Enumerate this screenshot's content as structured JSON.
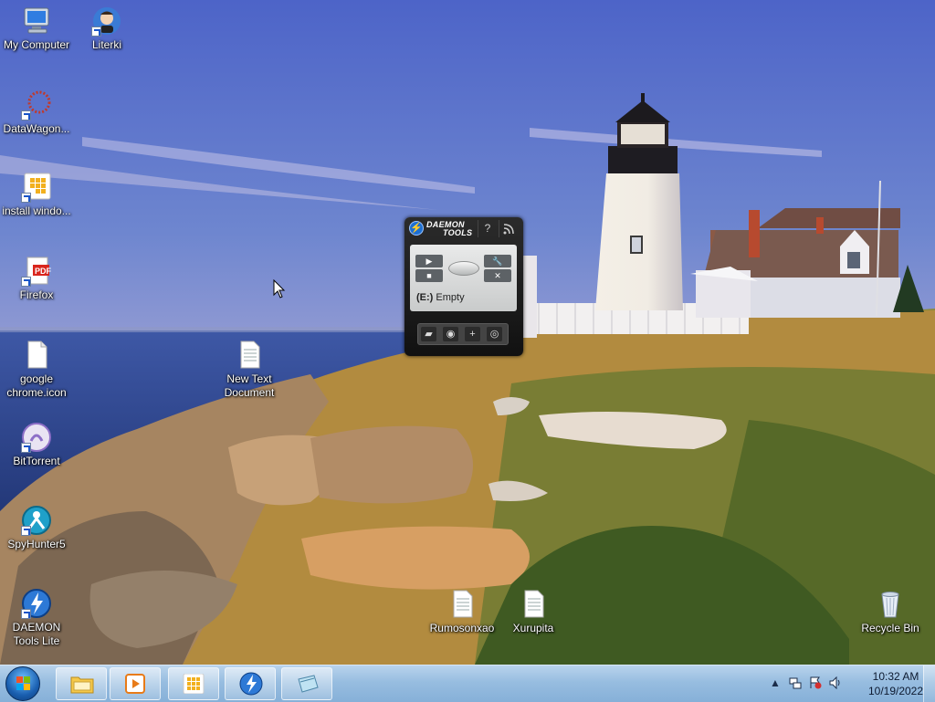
{
  "desktop": {
    "icons": [
      {
        "label": "My Computer",
        "icon": "computer-icon"
      },
      {
        "label": "Literki",
        "icon": "literki-app-icon"
      },
      {
        "label": "DataWagon...",
        "icon": "datawagon-icon"
      },
      {
        "label": "install windo...",
        "icon": "installer-icon"
      },
      {
        "label": "Firefox",
        "icon": "pdf-file-icon"
      },
      {
        "label": "google chrome.icon",
        "icon": "blank-file-icon"
      },
      {
        "label": "New Text Document",
        "icon": "text-document-icon"
      },
      {
        "label": "BitTorrent",
        "icon": "bittorrent-icon"
      },
      {
        "label": "SpyHunter5",
        "icon": "spyhunter-icon"
      },
      {
        "label": "DAEMON Tools Lite",
        "icon": "daemon-tools-icon"
      },
      {
        "label": "Rumosonxao",
        "icon": "text-document-icon"
      },
      {
        "label": "Xurupita",
        "icon": "text-document-icon"
      },
      {
        "label": "Recycle Bin",
        "icon": "recycle-bin-icon"
      }
    ]
  },
  "gadget": {
    "brand_line1": "DAEMON",
    "brand_line2": "TOOLS",
    "help": "?",
    "drive_status": "(E:) Empty",
    "drive_letter": "(E:)",
    "drive_text": "Empty"
  },
  "taskbar": {
    "buttons": [
      "windows-explorer",
      "media-player",
      "app-grid",
      "daemon-tools",
      "notepad"
    ],
    "clock_time": "10:32 AM",
    "clock_date": "10/19/2022"
  },
  "colors": {
    "taskbar": "#97bde0",
    "accent": "#1e6fd1",
    "label_text": "#ffffff"
  }
}
